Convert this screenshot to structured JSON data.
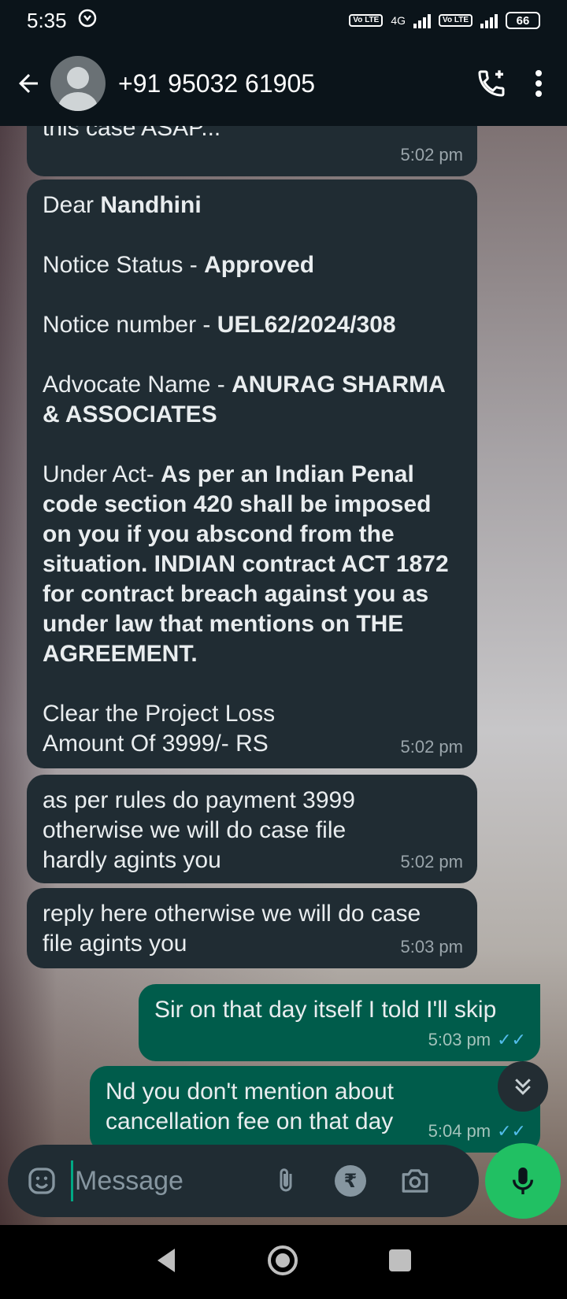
{
  "status_bar": {
    "time": "5:35",
    "network": "4G",
    "volte": "Vo LTE",
    "battery": "66"
  },
  "header": {
    "contact": "+91 95032 61905"
  },
  "messages": [
    {
      "lines": [
        "this case ASAP..."
      ],
      "time": "5:02 pm"
    },
    {
      "greeting_label": "Dear ",
      "greeting_value": "Nandhini",
      "status_label": "Notice Status - ",
      "status_value": "Approved",
      "number_label": "Notice number - ",
      "number_value": "UEL62/2024/308",
      "advocate_label": "Advocate Name - ",
      "advocate_value": "ANURAG SHARMA & ASSOCIATES",
      "act_label": "Under Act- ",
      "act_value": "As per an Indian Penal code section 420 shall be imposed on you if you abscond from the situation. INDIAN contract ACT 1872 for contract breach against you as under law that mentions on THE AGREEMENT.",
      "clear_line1": "Clear the Project Loss",
      "clear_line2": "Amount Of 3999/- RS",
      "time": "5:02 pm"
    },
    {
      "text": "as per rules do payment 3999 otherwise we will do case file hardly agints you",
      "time": "5:02 pm"
    },
    {
      "text": "reply here otherwise we will do case file agints you",
      "time": "5:03 pm"
    },
    {
      "text": "Sir on that day itself I told I'll skip",
      "time": "5:03 pm"
    },
    {
      "text": "Nd you don't mention about cancellation fee on that day",
      "time": "5:04 pm"
    }
  ],
  "composer": {
    "placeholder": "Message",
    "rupee": "₹"
  }
}
